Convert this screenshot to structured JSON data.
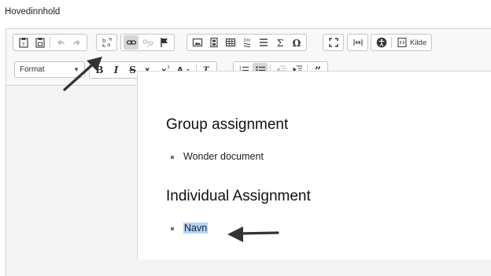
{
  "field_label": "Hovedinnhold",
  "toolbar": {
    "source_label": "Kilde",
    "format_combo": {
      "selected": "Format"
    }
  },
  "document": {
    "heading_1": "Group assignment",
    "item_1": "Wonder document",
    "heading_2": "Individual Assignment",
    "item_2": "Navn"
  },
  "icons": {
    "row1": [
      "paste-text-icon",
      "paste-word-icon",
      "undo-icon",
      "redo-icon",
      "lang-direction-icon",
      "link-icon",
      "unlink-icon",
      "anchor-icon",
      "image-icon",
      "media-icon",
      "table-icon",
      "div-icon",
      "horizontal-line-icon",
      "math-icon",
      "special-char-icon",
      "maximize-icon",
      "show-blocks-icon",
      "accessibility-icon",
      "source-icon"
    ],
    "row2": [
      "bold-icon",
      "italic-icon",
      "strike-icon",
      "subscript-icon",
      "superscript-icon",
      "text-color-icon",
      "remove-format-icon",
      "numbered-list-icon",
      "bulleted-list-icon",
      "outdent-icon",
      "indent-icon",
      "blockquote-icon"
    ]
  },
  "colors": {
    "selection": "#b3d4fc",
    "active_button": "#d6d6d6",
    "arrow": "#333333"
  }
}
